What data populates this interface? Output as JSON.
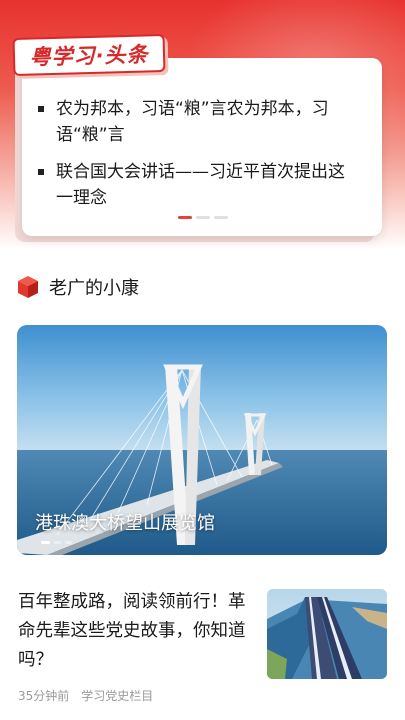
{
  "headline": {
    "brand": "粤学习·头条",
    "items": [
      {
        "text": "农为邦本，习语“粮”言农为邦本，习语“粮”言"
      },
      {
        "text": "联合国大会讲话——习近平首次提出这一理念"
      }
    ],
    "active_slide": 1,
    "slide_count": 3
  },
  "section": {
    "title": "老广的小康",
    "icon": "cube-icon"
  },
  "feature": {
    "caption": "港珠澳大桥望山展览馆"
  },
  "article": {
    "title": "百年整成路，阅读领前行！革命先辈这些党史故事，你知道吗？",
    "time": "35分钟前",
    "source": "学习党史栏目"
  },
  "colors": {
    "brand_red": "#d8292a",
    "accent_red": "#e8403a"
  }
}
